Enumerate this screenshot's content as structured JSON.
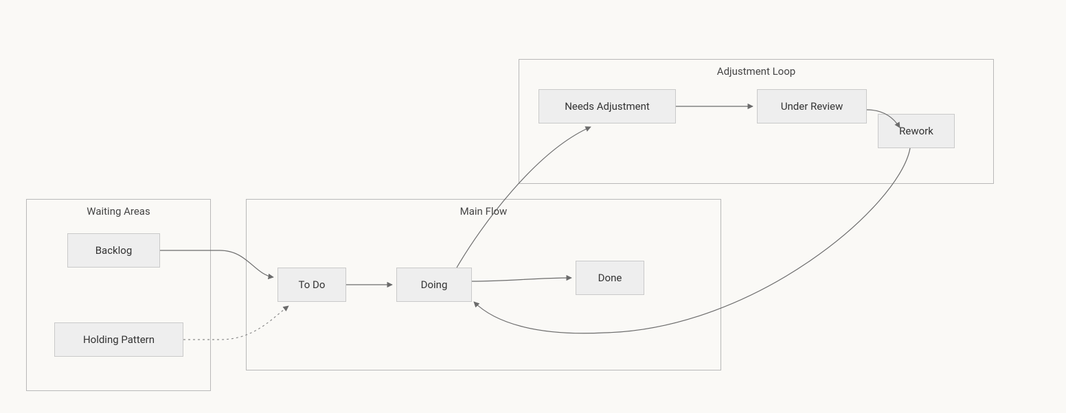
{
  "groups": {
    "waiting": {
      "title": "Waiting Areas"
    },
    "main": {
      "title": "Main Flow"
    },
    "adjustment": {
      "title": "Adjustment Loop"
    }
  },
  "nodes": {
    "backlog": {
      "label": "Backlog"
    },
    "holding_pattern": {
      "label": "Holding Pattern"
    },
    "todo": {
      "label": "To Do"
    },
    "doing": {
      "label": "Doing"
    },
    "done": {
      "label": "Done"
    },
    "needs_adjustment": {
      "label": "Needs Adjustment"
    },
    "under_review": {
      "label": "Under Review"
    },
    "rework": {
      "label": "Rework"
    }
  },
  "edges": [
    {
      "from": "backlog",
      "to": "todo",
      "style": "solid"
    },
    {
      "from": "holding_pattern",
      "to": "todo",
      "style": "dotted"
    },
    {
      "from": "todo",
      "to": "doing",
      "style": "solid"
    },
    {
      "from": "doing",
      "to": "done",
      "style": "solid"
    },
    {
      "from": "doing",
      "to": "needs_adjustment",
      "style": "solid"
    },
    {
      "from": "needs_adjustment",
      "to": "under_review",
      "style": "solid"
    },
    {
      "from": "under_review",
      "to": "rework",
      "style": "solid"
    },
    {
      "from": "rework",
      "to": "doing",
      "style": "solid"
    }
  ]
}
